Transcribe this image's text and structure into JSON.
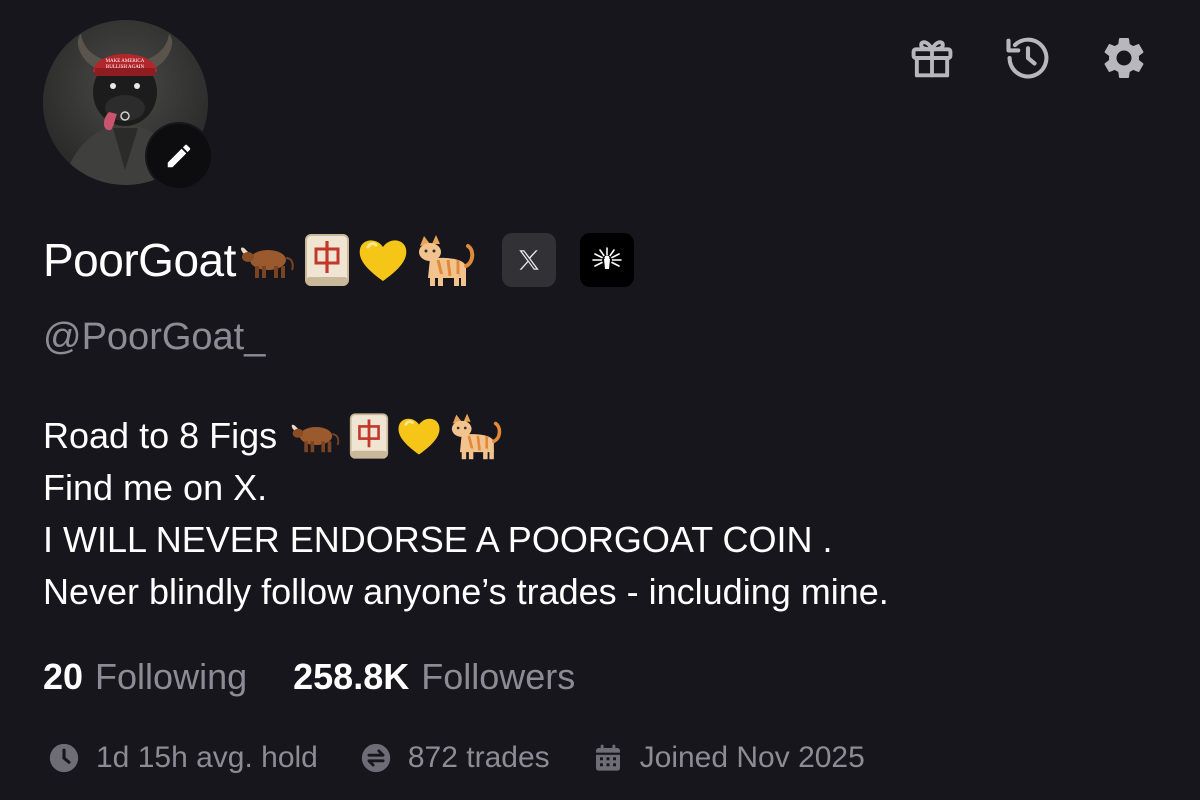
{
  "header": {
    "icons": [
      "gift-icon",
      "history-icon",
      "settings-gear-icon"
    ]
  },
  "profile": {
    "display_name": "PoorGoat",
    "name_emojis": [
      "ox-emoji",
      "mahjong-red-dragon-emoji",
      "yellow-heart-emoji",
      "cat-emoji"
    ],
    "social_links": [
      "x-logo-icon",
      "dexscreener-logo-icon"
    ],
    "handle": "@PoorGoat_",
    "bio": {
      "line1": "Road to 8 Figs",
      "line1_emojis": [
        "ox-emoji",
        "mahjong-red-dragon-emoji",
        "yellow-heart-emoji",
        "cat-emoji"
      ],
      "line2": "Find me on X.",
      "line3": "I WILL NEVER ENDORSE A POORGOAT COIN .",
      "line4": "Never blindly follow anyone’s trades - including mine."
    },
    "stats": {
      "following_count": "20",
      "following_label": "Following",
      "followers_count": "258.8K",
      "followers_label": "Followers"
    },
    "meta": {
      "avg_hold": "1d 15h avg. hold",
      "trades": "872 trades",
      "joined": "Joined Nov 2025"
    }
  },
  "colors": {
    "background": "#17161c",
    "text_primary": "#ffffff",
    "text_secondary": "#8d8b93",
    "icon_gray": "#b9b7be"
  }
}
